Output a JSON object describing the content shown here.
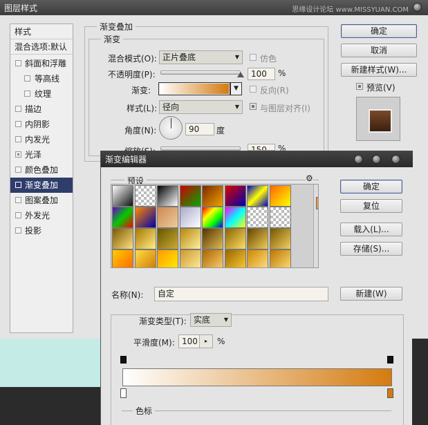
{
  "layer_style": {
    "title": "图层样式",
    "watermark": "思缘设计论坛 www.MISSYUAN.COM",
    "sidebar": {
      "header": "样式",
      "blend_options": "混合选项:默认",
      "items": [
        {
          "label": "斜面和浮雕",
          "checked": false,
          "sub": false
        },
        {
          "label": "等高线",
          "checked": false,
          "sub": true
        },
        {
          "label": "纹理",
          "checked": false,
          "sub": true
        },
        {
          "label": "描边",
          "checked": false,
          "sub": false
        },
        {
          "label": "内阴影",
          "checked": false,
          "sub": false
        },
        {
          "label": "内发光",
          "checked": false,
          "sub": false
        },
        {
          "label": "光泽",
          "checked": true,
          "sub": false
        },
        {
          "label": "颜色叠加",
          "checked": false,
          "sub": false
        },
        {
          "label": "渐变叠加",
          "checked": true,
          "sub": false,
          "selected": true
        },
        {
          "label": "图案叠加",
          "checked": false,
          "sub": false
        },
        {
          "label": "外发光",
          "checked": false,
          "sub": false
        },
        {
          "label": "投影",
          "checked": false,
          "sub": false
        }
      ]
    },
    "panel": {
      "group_title": "渐变叠加",
      "sub_title": "渐变",
      "blend_mode_label": "混合模式(O):",
      "blend_mode_value": "正片叠底",
      "dither_label": "仿色",
      "opacity_label": "不透明度(P):",
      "opacity_value": "100",
      "opacity_unit": "%",
      "opacity_level_percent": 100,
      "gradient_label": "渐变:",
      "reverse_label": "反向(R)",
      "style_label": "样式(L):",
      "style_value": "径向",
      "align_label": "与图层对齐(I)",
      "angle_label": "角度(N):",
      "angle_value": "90",
      "angle_unit": "度",
      "scale_label": "缩放(S):",
      "scale_value": "150",
      "scale_unit": "%"
    },
    "buttons": {
      "ok": "确定",
      "cancel": "取消",
      "new_style": "新建样式(W)...",
      "preview": "预览(V)"
    }
  },
  "gradient_editor": {
    "title": "渐变编辑器",
    "presets_label": "预设",
    "buttons": {
      "ok": "确定",
      "reset": "复位",
      "load": "载入(L)...",
      "save": "存储(S)...",
      "new": "新建(W)"
    },
    "name_label": "名称(N):",
    "name_value": "自定",
    "type_label": "渐变类型(T):",
    "type_value": "实底",
    "smooth_label": "平滑度(M):",
    "smooth_value": "100",
    "smooth_unit": "%",
    "stops_label": "色标",
    "gradient_colors": [
      "#ffffff",
      "#d47b10"
    ],
    "presets": [
      [
        "#fff|#111",
        "checker|#eee",
        "#000|#fff",
        "#c00|#0a0",
        "#7a2a00|#f0a000",
        "#d00|#00a",
        "#00c|#ff0|#00c",
        "#f60|#ff0"
      ],
      [
        "#60c|#0c0|#f00",
        "#f80|#00a",
        "#cc8855|#eecc99",
        "#aac|#fff",
        "#f00|#ff0|#0f0|#00f",
        "#f0f|#0ff|#ff0",
        "checker|#ccc",
        "checker|#aaa"
      ],
      [
        "#7a5a00|#ffe080",
        "#aa7700|#ffee88",
        "#665500|#ccaa33",
        "#b8860b|#fff0a0",
        "#553300|#ddbb55",
        "#886600|#ffdd66",
        "#664400|#eecc55",
        "#775500|#f2d060"
      ],
      [
        "#ffcc00|#ff6600",
        "#ffdd44|#cc7700",
        "#ff9900|#ffee00",
        "#cc9933|#ffee99",
        "#aa6600|#ffd070",
        "#996600|#ffcc33",
        "#cc8800|#ffe088",
        "#bb7700|#ffdd77"
      ]
    ]
  }
}
